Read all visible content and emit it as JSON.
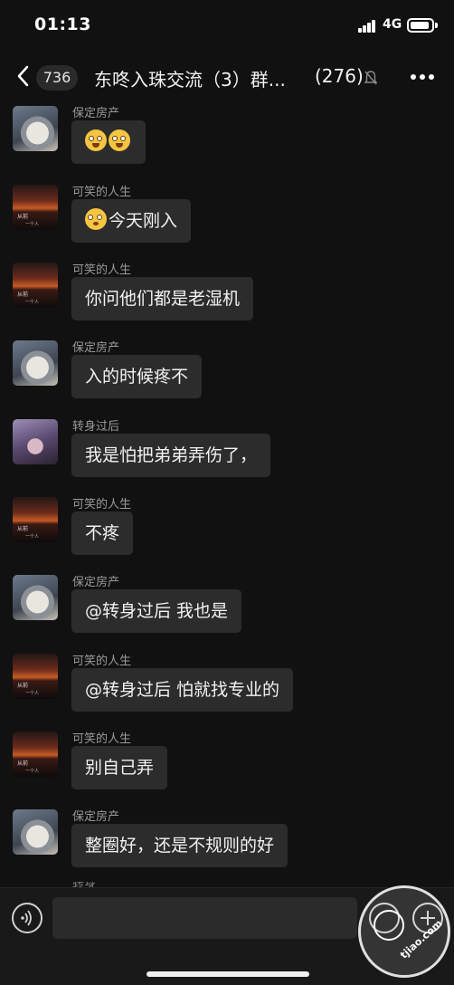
{
  "status": {
    "time": "01:13",
    "network": "4G"
  },
  "header": {
    "unread_count": "736",
    "title": "东咚入珠交流（3）群...",
    "member_count": "(276)"
  },
  "messages": [
    {
      "sender": "保定房产",
      "avatar": "dog-avatar",
      "text": "",
      "emoji_count": 2
    },
    {
      "sender": "可笑的人生",
      "avatar": "sunset-avatar",
      "text": "今天刚入",
      "emoji_count": 1
    },
    {
      "sender": "可笑的人生",
      "avatar": "sunset-avatar",
      "text": "你问他们都是老湿机",
      "emoji_count": 0
    },
    {
      "sender": "保定房产",
      "avatar": "dog-avatar",
      "text": "入的时候疼不",
      "emoji_count": 0
    },
    {
      "sender": "转身过后",
      "avatar": "person-avatar",
      "text": "我是怕把弟弟弄伤了，",
      "emoji_count": 0
    },
    {
      "sender": "可笑的人生",
      "avatar": "sunset-avatar",
      "text": "不疼",
      "emoji_count": 0
    },
    {
      "sender": "保定房产",
      "avatar": "dog-avatar",
      "text": "@转身过后 我也是",
      "emoji_count": 0
    },
    {
      "sender": "可笑的人生",
      "avatar": "sunset-avatar",
      "text": "@转身过后 怕就找专业的",
      "emoji_count": 0
    },
    {
      "sender": "可笑的人生",
      "avatar": "sunset-avatar",
      "text": "别自己弄",
      "emoji_count": 0
    },
    {
      "sender": "保定房产",
      "avatar": "dog-avatar",
      "text": "整圈好，还是不规则的好",
      "emoji_count": 0
    }
  ],
  "avatar_texts": {
    "line1": "从前",
    "line2": "一个人"
  },
  "partial_sender": "转身",
  "input": {
    "value": ""
  },
  "watermark": {
    "text": "tjiao.com"
  },
  "colors": {
    "background": "#111111",
    "bubble": "#2c2c2c",
    "sender_text": "#9a9a9a"
  }
}
